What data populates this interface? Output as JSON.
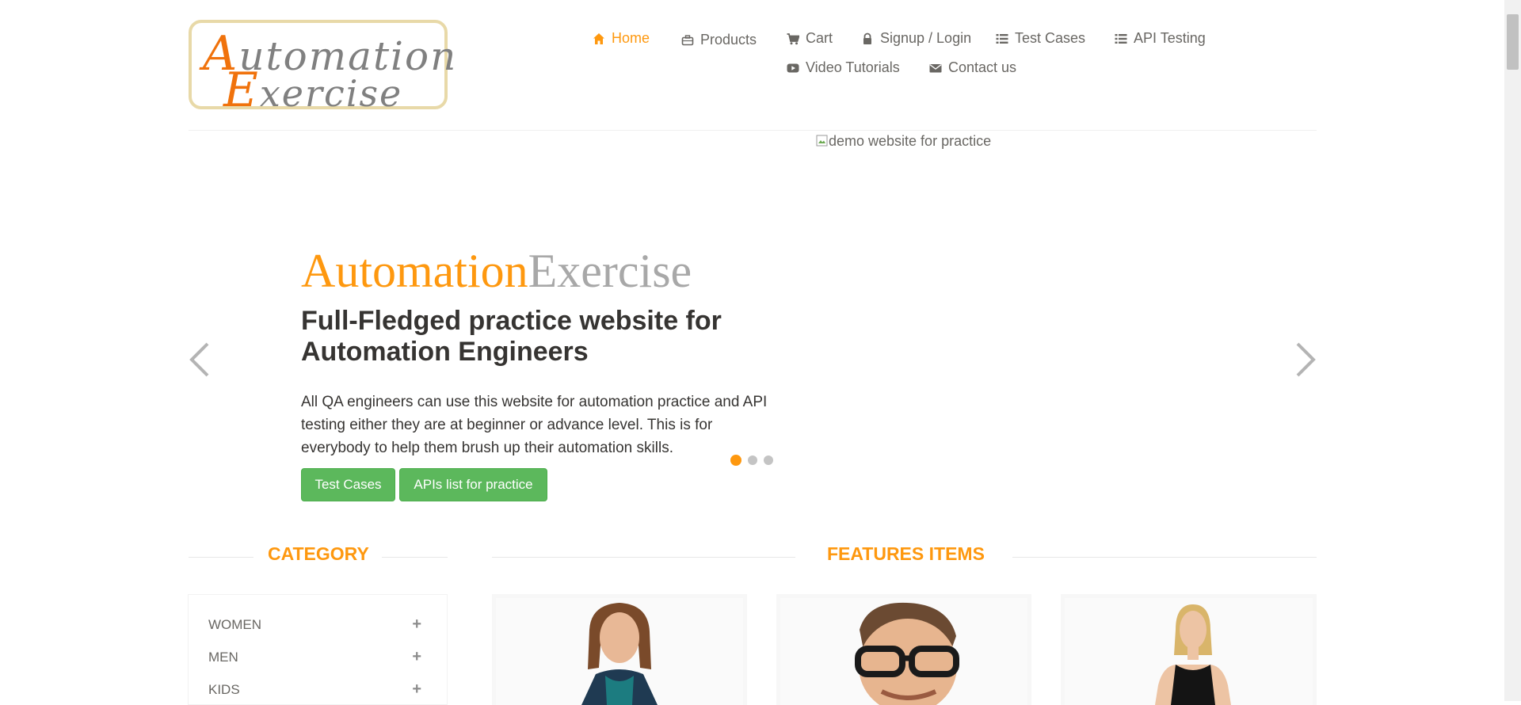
{
  "logo": {
    "line1_cap": "A",
    "line1_rest": "utomation",
    "line2_cap": "E",
    "line2_rest": "xercise"
  },
  "nav": [
    {
      "label": "Home",
      "icon": "home-icon"
    },
    {
      "label": "Products",
      "icon": "briefcase-icon"
    },
    {
      "label": "Cart",
      "icon": "cart-icon"
    },
    {
      "label": "Signup / Login",
      "icon": "lock-icon"
    },
    {
      "label": "Test Cases",
      "icon": "list-icon"
    },
    {
      "label": "API Testing",
      "icon": "list-icon"
    },
    {
      "label": "Video Tutorials",
      "icon": "youtube-icon"
    },
    {
      "label": "Contact us",
      "icon": "envelope-icon"
    }
  ],
  "hero": {
    "image_alt": "demo website for practice",
    "brand_a": "Automation",
    "brand_b": "Exercise",
    "title": "Full-Fledged practice website for Automation Engineers",
    "description": "All QA engineers can use this website for automation practice and API testing either they are at beginner or advance level. This is for everybody to help them brush up their automation skills.",
    "btn_test_cases": "Test Cases",
    "btn_apis": "APIs list for practice"
  },
  "sections": {
    "category": "CATEGORY",
    "features": "FEATURES ITEMS"
  },
  "categories": [
    {
      "label": "WOMEN",
      "toggle": "+"
    },
    {
      "label": "MEN",
      "toggle": "+"
    },
    {
      "label": "KIDS",
      "toggle": "+"
    }
  ],
  "colors": {
    "accent": "#FE980F",
    "button": "#5cb85c",
    "text": "#696763",
    "heading": "#363432"
  }
}
